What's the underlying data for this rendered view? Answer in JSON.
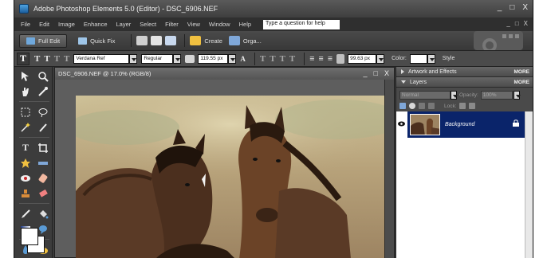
{
  "window": {
    "title": "Adobe Photoshop Elements 5.0 (Editor) - DSC_6906.NEF",
    "controls": [
      "_",
      "□",
      "X"
    ]
  },
  "menu": {
    "items": [
      "File",
      "Edit",
      "Image",
      "Enhance",
      "Layer",
      "Select",
      "Filter",
      "View",
      "Window",
      "Help"
    ],
    "help_placeholder": "Type a question for help",
    "right_controls": [
      "_",
      "□",
      "X"
    ]
  },
  "modebar": {
    "full_edit": "Full Edit",
    "quick_fix": "Quick Fix",
    "create": "Create",
    "organize": "Orga..."
  },
  "options": {
    "font_family": "Verdana Ref",
    "font_style": "Regular",
    "font_size": "119.55 px",
    "leading": "99.63 px",
    "color_label": "Color:",
    "style_label": "Style"
  },
  "document": {
    "title": "DSC_6906.NEF @ 17.0% (RGB/8)",
    "controls": [
      "_",
      "□",
      "X"
    ]
  },
  "panels": {
    "artwork": {
      "label": "Artwork and Effects",
      "more": "MORE"
    },
    "layers": {
      "label": "Layers",
      "more": "MORE"
    },
    "blend_mode": "Normal",
    "opacity_label": "Opacity:",
    "opacity_value": "100%",
    "lock_label": "Lock:",
    "layer_name": "Background"
  },
  "colors": {
    "selected_layer": "#0a246a",
    "chrome": "#3b3b3b"
  }
}
